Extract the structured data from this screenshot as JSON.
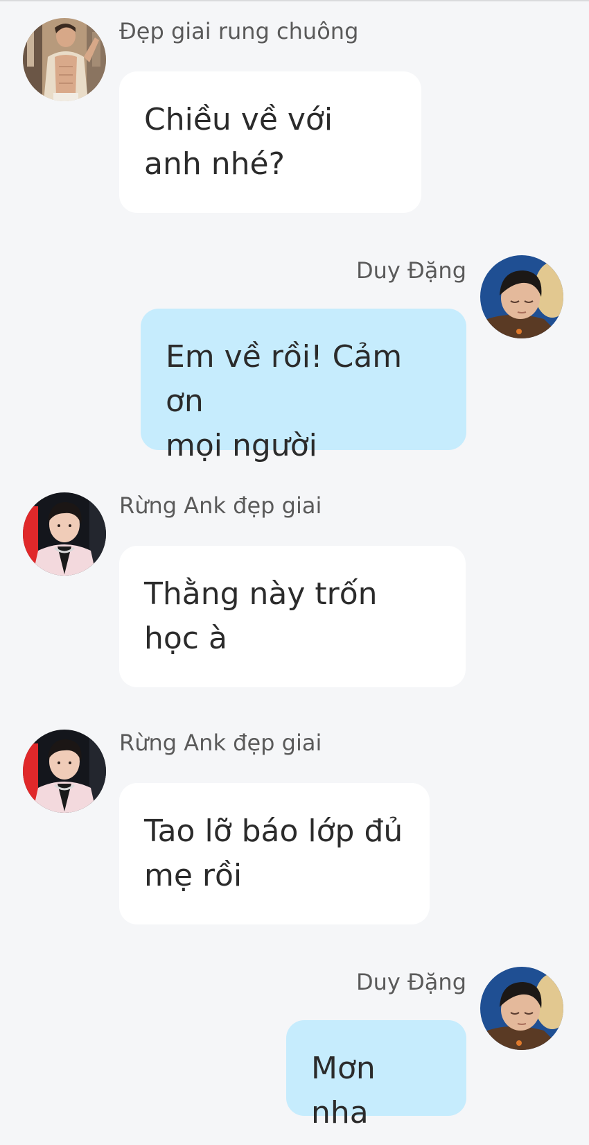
{
  "messages": [
    {
      "sender": "Đẹp giai rung chuông",
      "text": "Chiều về với anh nhé?",
      "line1": "Chiều về với",
      "line2": "anh nhé?",
      "avatar": "shirtless-man-avatar",
      "side": "incoming"
    },
    {
      "sender": "Duy Đặng",
      "text": "Em về rồi! Cảm ơn mọi người",
      "line1": "Em về rồi! Cảm ơn",
      "line2": "mọi người",
      "avatar": "sleeping-boy-avatar",
      "side": "outgoing"
    },
    {
      "sender": "Rừng Ank đẹp giai",
      "text": "Thằng này trốn học à",
      "line1": "Thằng này trốn",
      "line2": "học à",
      "avatar": "pink-suit-man-avatar",
      "side": "incoming"
    },
    {
      "sender": "Rừng Ank đẹp giai",
      "text": "Tao lỡ báo lớp đủ mẹ rồi",
      "line1": "Tao lỡ báo lớp đủ",
      "line2": "mẹ rồi",
      "avatar": "pink-suit-man-avatar",
      "side": "incoming"
    },
    {
      "sender": "Duy Đặng",
      "text": "Mơn nha",
      "line1": "Mơn nha",
      "avatar": "sleeping-boy-avatar",
      "side": "outgoing"
    }
  ],
  "colors": {
    "background": "#f5f6f8",
    "incoming_bubble": "#ffffff",
    "outgoing_bubble": "#c6ecfd",
    "sender_text": "#5a5a5a",
    "message_text": "#2b2b2b"
  }
}
